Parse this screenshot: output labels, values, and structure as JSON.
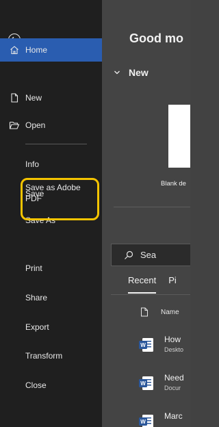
{
  "sidebar": {
    "back_label": "Back",
    "items": [
      {
        "label": "Home"
      },
      {
        "label": "New"
      },
      {
        "label": "Open"
      },
      {
        "label": "Info"
      },
      {
        "label": "Save"
      },
      {
        "label": "Save As"
      },
      {
        "label_line1": "Save as Adobe",
        "label_line2": "PDF"
      },
      {
        "label": "Print"
      },
      {
        "label": "Share"
      },
      {
        "label": "Export"
      },
      {
        "label": "Transform"
      },
      {
        "label": "Close"
      }
    ]
  },
  "main": {
    "greeting": "Good mo",
    "new_section": "New",
    "blank_label": "Blank de",
    "search_placeholder": "Sea",
    "tabs": [
      {
        "label": "Recent"
      },
      {
        "label": "Pi"
      }
    ],
    "column_name": "Name",
    "files": [
      {
        "name": "How",
        "path": "Deskto"
      },
      {
        "name": "Need",
        "path": "Docur"
      },
      {
        "name": "Marc",
        "path": ""
      }
    ]
  },
  "colors": {
    "sidebar_bg": "#1f1f1f",
    "active_item": "#2a5db0",
    "highlight_ring": "#f5c400",
    "word_blue": "#2b579a"
  }
}
